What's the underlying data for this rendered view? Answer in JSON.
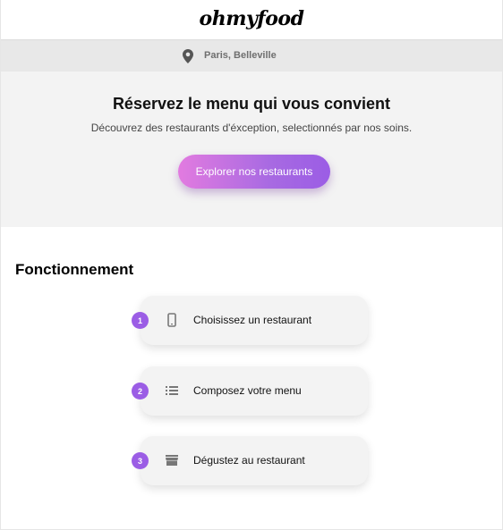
{
  "header": {
    "logo": "ohmyfood"
  },
  "location": {
    "icon": "map-pin-icon",
    "text": "Paris, Belleville"
  },
  "hero": {
    "title": "Réservez le menu qui vous convient",
    "subtitle": "Découvrez des restaurants d'éxception, selectionnés par nos soins.",
    "cta_label": "Explorer nos restaurants"
  },
  "how_it_works": {
    "title": "Fonctionnement",
    "steps": [
      {
        "number": "1",
        "icon": "smartphone-icon",
        "label": "Choisissez un restaurant"
      },
      {
        "number": "2",
        "icon": "list-icon",
        "label": "Composez votre menu"
      },
      {
        "number": "3",
        "icon": "store-icon",
        "label": "Dégustez au restaurant"
      }
    ]
  },
  "colors": {
    "accent": "#9b5de5",
    "cta_start": "#e27be0",
    "cta_end": "#9b5de5",
    "hero_bg": "#f3f3f3",
    "location_bg": "#e8e8e8"
  }
}
